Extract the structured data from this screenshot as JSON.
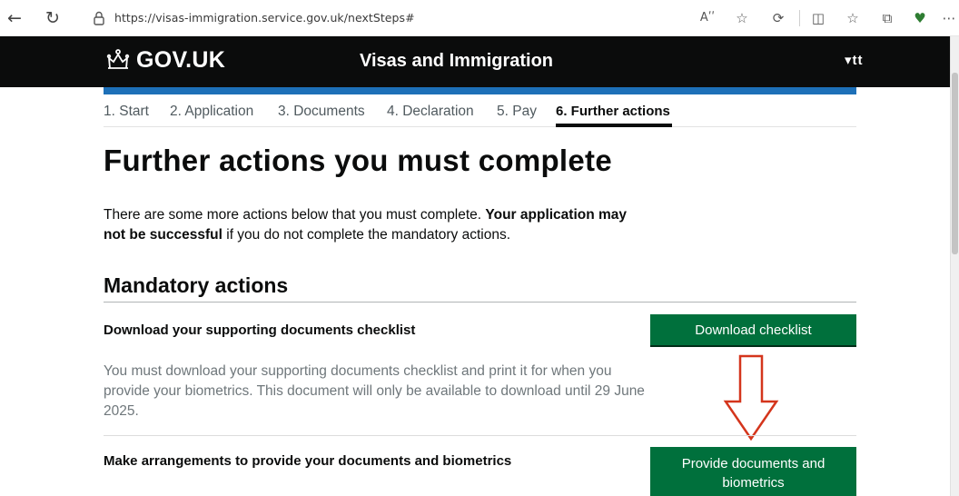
{
  "browser": {
    "url": "https://visas-immigration.service.gov.uk/nextSteps#",
    "reader_label": "Aʹʹ"
  },
  "header": {
    "logo": "GOV.UK",
    "service_name": "Visas and Immigration",
    "language_toggle": "▾tt"
  },
  "steps": [
    {
      "label": "1. Start"
    },
    {
      "label": "2. Application"
    },
    {
      "label": "3. Documents"
    },
    {
      "label": "4. Declaration"
    },
    {
      "label": "5. Pay"
    },
    {
      "label": "6. Further actions",
      "active": true
    }
  ],
  "main": {
    "title": "Further actions you must complete",
    "intro_part1": "There are some more actions below that you must complete. ",
    "intro_bold1": "Your application may not be successful",
    "intro_part2": " if you do not complete the mandatory actions.",
    "section_title": "Mandatory actions",
    "actions": [
      {
        "title": "Download your supporting documents checklist",
        "description": "You must download your supporting documents checklist and print it for when you provide your biometrics. This document will only be available to download until 29 June 2025.",
        "button": "Download checklist"
      },
      {
        "title": "Make arrangements to provide your documents and biometrics",
        "button": "Provide documents and biometrics"
      }
    ]
  },
  "colors": {
    "header_bg": "#0b0c0c",
    "accent_blue": "#1d70b8",
    "button_green": "#00703c",
    "arrow_red": "#d4351c"
  }
}
